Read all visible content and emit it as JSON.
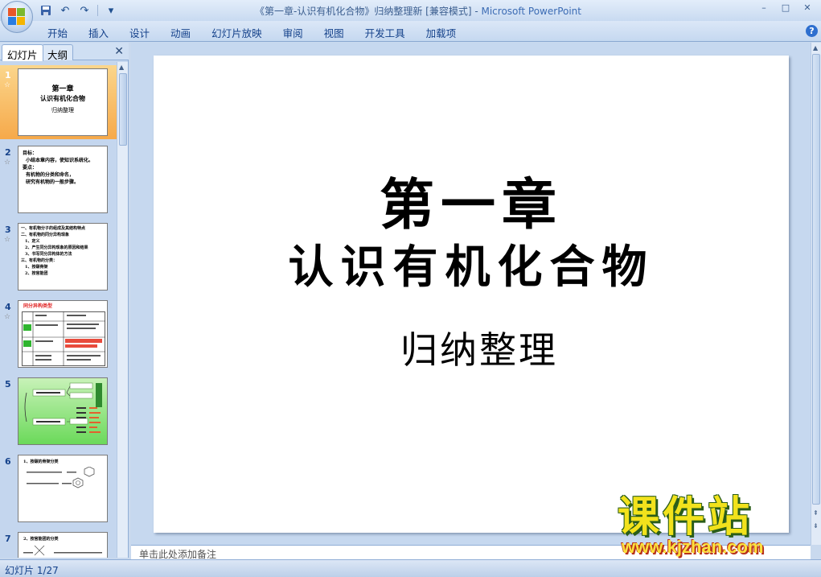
{
  "window": {
    "title_doc": "《第一章-认识有机化合物》归纳整理新 [兼容模式] - ",
    "title_app": "Microsoft PowerPoint"
  },
  "qat": {
    "save": "save-icon",
    "undo": "↶",
    "redo": "↷",
    "more": "▾"
  },
  "window_controls": {
    "minimize": "–",
    "maximize": "□",
    "close": "✕"
  },
  "ribbon": {
    "tabs": [
      "开始",
      "插入",
      "设计",
      "动画",
      "幻灯片放映",
      "审阅",
      "视图",
      "开发工具",
      "加载项"
    ],
    "help": "?"
  },
  "left_panel": {
    "tab_slides": "幻灯片",
    "tab_outline": "大纲",
    "close": "✕",
    "anim_marker": "☆",
    "thumbnails": [
      {
        "num": "1",
        "title1": "第一章",
        "title2": "认识有机化合物",
        "title3": "归纳整理"
      },
      {
        "num": "2",
        "lines": [
          "目标：",
          "小结本章内容，使知识系统化。",
          "要点：",
          "有机物的分类和命名，",
          "研究有机物的一般步骤。"
        ]
      },
      {
        "num": "3",
        "lines": [
          "一、有机物分子的组成及其结构特点",
          "二、有机物的同分异构现象",
          "1、定义",
          "2、产生同分异构现象的原因和结果",
          "3、书写同分异构体的方法",
          "三、有机物的分类：",
          "1、按碳骨架",
          "2、按官能团"
        ]
      },
      {
        "num": "4",
        "title": "同分异构类型"
      },
      {
        "num": "5"
      },
      {
        "num": "6",
        "lines": [
          "1、按碳的骨架分类"
        ]
      },
      {
        "num": "7",
        "lines": [
          "2、按官能团的分类"
        ]
      }
    ]
  },
  "slide": {
    "title_line1": "第一章",
    "title_line2": "认识有机化合物",
    "subtitle": "归纳整理"
  },
  "notes": {
    "placeholder": "单击此处添加备注"
  },
  "status": {
    "slide_info": "幻灯片 1/27"
  },
  "watermark": {
    "text": "课件站",
    "url": "www.kjzhan.com"
  }
}
